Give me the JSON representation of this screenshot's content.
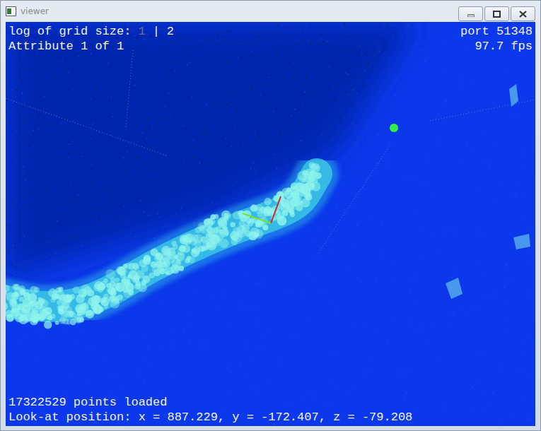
{
  "window": {
    "title": "viewer"
  },
  "overlay": {
    "grid_size": {
      "label": "log of grid size:",
      "separator": "|",
      "options": [
        {
          "label": "1",
          "selected": false
        },
        {
          "label": "2",
          "selected": true
        }
      ]
    },
    "attribute": "Attribute 1 of 1",
    "port": "port 51348",
    "fps": "97.7 fps",
    "points": "17322529 points loaded",
    "look_at": "Look-at position: x = 887.229, y = -172.407, z = -79.208"
  }
}
